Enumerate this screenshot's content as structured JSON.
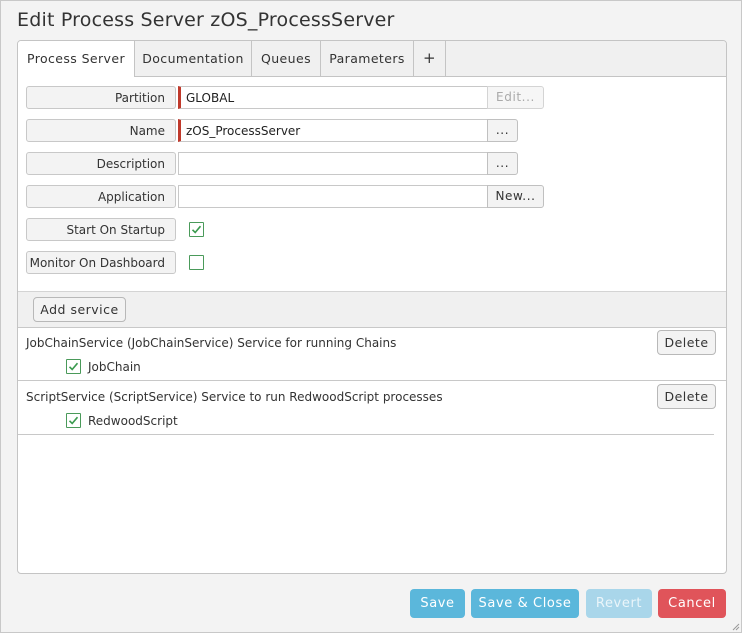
{
  "dialog": {
    "title": "Edit Process Server zOS_ProcessServer"
  },
  "tabs": [
    {
      "label": "Process Server",
      "active": true
    },
    {
      "label": "Documentation"
    },
    {
      "label": "Queues"
    },
    {
      "label": "Parameters"
    },
    {
      "label": "+"
    }
  ],
  "form": {
    "partition": {
      "label": "Partition",
      "value": "GLOBAL",
      "button": "Edit..."
    },
    "name": {
      "label": "Name",
      "value": "zOS_ProcessServer",
      "button": "..."
    },
    "description": {
      "label": "Description",
      "value": "",
      "button": "..."
    },
    "application": {
      "label": "Application",
      "value": "",
      "button": "New..."
    },
    "start_on_startup": {
      "label": "Start On Startup",
      "checked": true
    },
    "monitor_on_dashboard": {
      "label": "Monitor On Dashboard",
      "checked": false
    }
  },
  "services": {
    "add_label": "Add service",
    "items": [
      {
        "text": "JobChainService (JobChainService) Service for running Chains",
        "delete_label": "Delete",
        "check_label": "JobChain",
        "checked": true
      },
      {
        "text": "ScriptService (ScriptService) Service to run RedwoodScript processes",
        "delete_label": "Delete",
        "check_label": "RedwoodScript",
        "checked": true
      }
    ]
  },
  "footer": {
    "save": "Save",
    "save_close": "Save & Close",
    "revert": "Revert",
    "cancel": "Cancel"
  },
  "colors": {
    "primary": "#5bb7db",
    "primary_disabled": "#a9d6ea",
    "danger": "#e0545a",
    "required": "#c0392b",
    "check": "#3a9a4e"
  },
  "icons": {
    "check": "check-icon"
  }
}
